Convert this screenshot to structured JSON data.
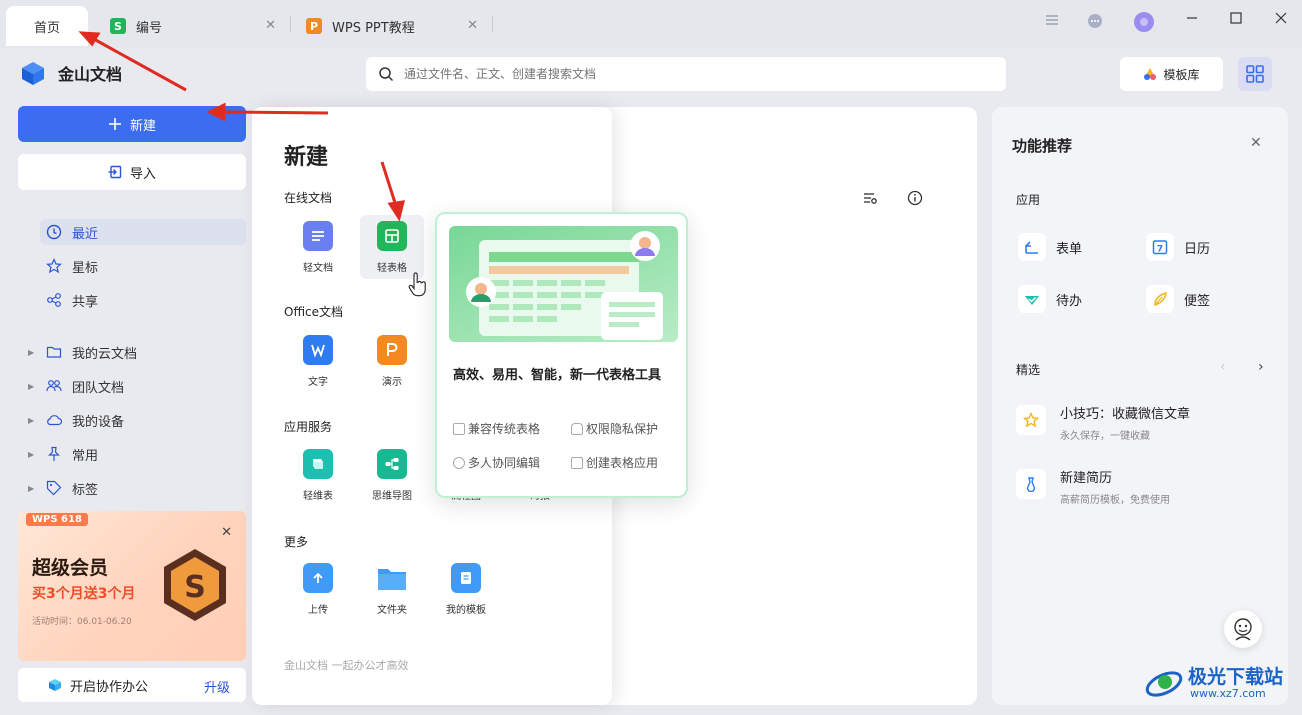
{
  "tabs": [
    {
      "label": "首页"
    },
    {
      "label": "编号",
      "icon": "S",
      "color": "#1fb55a"
    },
    {
      "label": "WPS PPT教程",
      "icon": "P",
      "color": "#f08a24"
    }
  ],
  "brand": {
    "name": "金山文档"
  },
  "search": {
    "placeholder": "通过文件名、正文、创建者搜索文档"
  },
  "header": {
    "template_label": "模板库"
  },
  "sidebar": {
    "new_label": "新建",
    "import_label": "导入",
    "nav": [
      {
        "label": "最近",
        "icon": "clock-icon",
        "active": true
      },
      {
        "label": "星标",
        "icon": "star-icon"
      },
      {
        "label": "共享",
        "icon": "share-icon"
      }
    ],
    "tree": [
      {
        "label": "我的云文档",
        "icon": "folder-icon"
      },
      {
        "label": "团队文档",
        "icon": "team-icon"
      },
      {
        "label": "我的设备",
        "icon": "cloud-icon"
      },
      {
        "label": "常用",
        "icon": "pin-icon"
      },
      {
        "label": "标签",
        "icon": "tag-icon"
      }
    ],
    "promo": {
      "badge": "WPS 618",
      "title": "超级会员",
      "subtitle": "买3个月送3个月",
      "date": "活动时间：06.01-06.20"
    },
    "collab": {
      "label": "开启协作办公",
      "upgrade": "升级"
    }
  },
  "new_panel": {
    "title": "新建",
    "sections": [
      {
        "label": "在线文档",
        "apps": [
          {
            "label": "轻文档",
            "icon": "light-doc-icon",
            "color": "#6a7ff0"
          },
          {
            "label": "轻表格",
            "icon": "light-sheet-icon",
            "color": "#22b55a"
          }
        ]
      },
      {
        "label": "Office文档",
        "apps": [
          {
            "label": "文字",
            "icon": "word-icon",
            "color": "#2f7cf0"
          },
          {
            "label": "演示",
            "icon": "presentation-icon",
            "color": "#f38a1f"
          }
        ]
      },
      {
        "label": "应用服务",
        "apps": [
          {
            "label": "轻维表",
            "icon": "light-table-icon",
            "color": "#1dbfb0"
          },
          {
            "label": "思维导图",
            "icon": "mindmap-icon",
            "color": "#17b892"
          },
          {
            "label": "流程图",
            "icon": "flowchart-icon",
            "color": "#3d8af7"
          },
          {
            "label": "海报",
            "icon": "poster-icon",
            "color": "#ef5a6f"
          }
        ]
      },
      {
        "label": "更多",
        "apps": [
          {
            "label": "上传",
            "icon": "upload-icon",
            "color": "#3f9bf5"
          },
          {
            "label": "文件夹",
            "icon": "folder-icon",
            "color": "#3f9bf5"
          },
          {
            "label": "我的模板",
            "icon": "template-icon",
            "color": "#3f9bf5"
          }
        ]
      }
    ],
    "footer": "金山文档    一起办公才高效"
  },
  "popup": {
    "title": "高效、易用、智能，新一代表格工具",
    "features": [
      "兼容传统表格",
      "权限隐私保护",
      "多人协同编辑",
      "创建表格应用"
    ]
  },
  "right_panel": {
    "title": "功能推荐",
    "apps_label": "应用",
    "apps": [
      {
        "label": "表单",
        "icon": "form-icon",
        "color": "#2f7cf0"
      },
      {
        "label": "日历",
        "icon": "calendar-icon",
        "color": "#2f7cf0"
      },
      {
        "label": "待办",
        "icon": "todo-icon",
        "color": "#1dbfb0"
      },
      {
        "label": "便签",
        "icon": "note-icon",
        "color": "#f2b51c"
      }
    ],
    "picks_label": "精选",
    "picks": [
      {
        "title": "小技巧：收藏微信文章",
        "sub": "永久保存，一键收藏",
        "icon": "star-icon",
        "color": "#f2b51c"
      },
      {
        "title": "新建简历",
        "sub": "高薪简历模板，免费使用",
        "icon": "resume-icon",
        "color": "#2f7cf0"
      }
    ]
  },
  "watermark": {
    "text": "极光下载站",
    "url": "www.xz7.com"
  }
}
